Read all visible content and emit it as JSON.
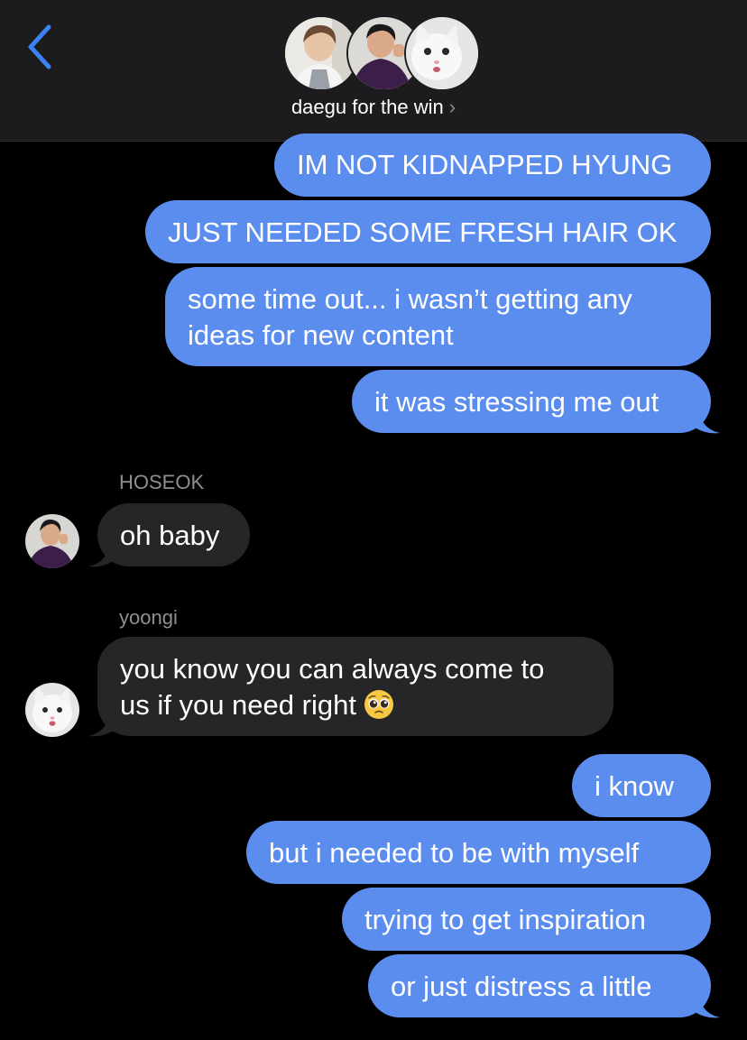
{
  "header": {
    "group_name": "daegu for the win",
    "chevron": "›",
    "back_icon": "chevron-left-icon",
    "accent_color": "#3b82f6"
  },
  "conversation": {
    "outgoing_color": "#5b8def",
    "incoming_color": "#262629",
    "messages": [
      {
        "sender": "me",
        "text": "IM NOT KIDNAPPED HYUNG"
      },
      {
        "sender": "me",
        "text": "JUST NEEDED SOME FRESH HAIR OK"
      },
      {
        "sender": "me",
        "text_lines": [
          "some time out... i wasn’t getting any",
          "ideas for new content"
        ]
      },
      {
        "sender": "me",
        "text": "it was stressing me out"
      },
      {
        "sender": "HOSEOK",
        "text": "oh baby"
      },
      {
        "sender": "yoongi",
        "text_lines": [
          "you know you can always come to",
          "us if you need right"
        ],
        "emoji": "pleading-face-emoji"
      },
      {
        "sender": "me",
        "text": "i know"
      },
      {
        "sender": "me",
        "text": "but i needed to be with myself"
      },
      {
        "sender": "me",
        "text": "trying to get inspiration"
      },
      {
        "sender": "me",
        "text": "or just distress a little"
      }
    ]
  }
}
